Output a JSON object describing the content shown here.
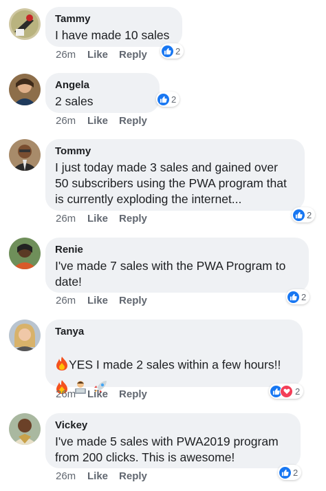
{
  "comments": [
    {
      "name": "Tammy",
      "text": "I have made 10 sales",
      "time": "26m",
      "like": "Like",
      "reply": "Reply",
      "reactions": "2"
    },
    {
      "name": "Angela",
      "text": "2 sales",
      "time": "26m",
      "like": "Like",
      "reply": "Reply",
      "reactions": "2"
    },
    {
      "name": "Tommy",
      "text": "I just today made 3 sales and gained over\n50 subscribers using the PWA program that\nis currently exploding the internet...",
      "time": "26m",
      "like": "Like",
      "reply": "Reply",
      "reactions": "2"
    },
    {
      "name": "Renie",
      "text": "I've made 7 sales with the PWA Program to\ndate!",
      "time": "26m",
      "like": "Like",
      "reply": "Reply",
      "reactions": "2"
    },
    {
      "name": "Tanya",
      "text": "YES I made 2 sales within a few hours!!",
      "time": "26m",
      "like": "Like",
      "reply": "Reply",
      "reactions": "2"
    },
    {
      "name": "Vickey",
      "text": "I've made 5 sales with PWA2019 program\nfrom 200 clicks. This is awesome!",
      "time": "26m",
      "like": "Like",
      "reply": "Reply",
      "reactions": "2"
    }
  ],
  "icons": {
    "like": "like-reaction-icon",
    "love": "love-reaction-icon",
    "fire": "fire-emoji",
    "tech": "technologist-emoji",
    "rocket": "rocket-emoji"
  },
  "colors": {
    "like": "#1877f2",
    "love": "#f33e58",
    "bubble": "#eff1f4",
    "meta": "#616770"
  }
}
